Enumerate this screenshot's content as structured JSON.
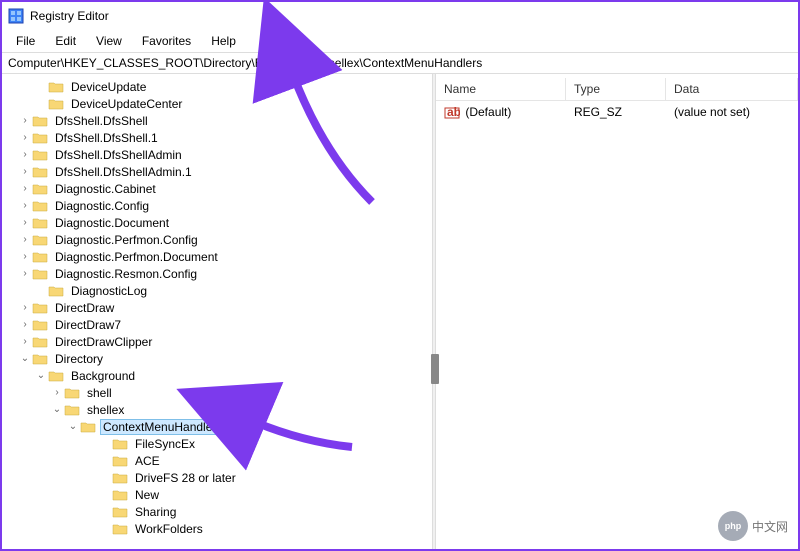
{
  "window": {
    "title": "Registry Editor"
  },
  "menu": {
    "file": "File",
    "edit": "Edit",
    "view": "View",
    "favorites": "Favorites",
    "help": "Help"
  },
  "address": "Computer\\HKEY_CLASSES_ROOT\\Directory\\Background\\shellex\\ContextMenuHandlers",
  "tree": [
    {
      "indent": 2,
      "chev": "none",
      "label": "DeviceUpdate"
    },
    {
      "indent": 2,
      "chev": "none",
      "label": "DeviceUpdateCenter"
    },
    {
      "indent": 1,
      "chev": "closed",
      "label": "DfsShell.DfsShell"
    },
    {
      "indent": 1,
      "chev": "closed",
      "label": "DfsShell.DfsShell.1"
    },
    {
      "indent": 1,
      "chev": "closed",
      "label": "DfsShell.DfsShellAdmin"
    },
    {
      "indent": 1,
      "chev": "closed",
      "label": "DfsShell.DfsShellAdmin.1"
    },
    {
      "indent": 1,
      "chev": "closed",
      "label": "Diagnostic.Cabinet"
    },
    {
      "indent": 1,
      "chev": "closed",
      "label": "Diagnostic.Config"
    },
    {
      "indent": 1,
      "chev": "closed",
      "label": "Diagnostic.Document"
    },
    {
      "indent": 1,
      "chev": "closed",
      "label": "Diagnostic.Perfmon.Config"
    },
    {
      "indent": 1,
      "chev": "closed",
      "label": "Diagnostic.Perfmon.Document"
    },
    {
      "indent": 1,
      "chev": "closed",
      "label": "Diagnostic.Resmon.Config"
    },
    {
      "indent": 2,
      "chev": "none",
      "label": "DiagnosticLog"
    },
    {
      "indent": 1,
      "chev": "closed",
      "label": "DirectDraw"
    },
    {
      "indent": 1,
      "chev": "closed",
      "label": "DirectDraw7"
    },
    {
      "indent": 1,
      "chev": "closed",
      "label": "DirectDrawClipper"
    },
    {
      "indent": 1,
      "chev": "open",
      "label": "Directory"
    },
    {
      "indent": 2,
      "chev": "open",
      "label": "Background"
    },
    {
      "indent": 3,
      "chev": "closed",
      "label": "shell"
    },
    {
      "indent": 3,
      "chev": "open",
      "label": "shellex"
    },
    {
      "indent": 4,
      "chev": "open",
      "label": "ContextMenuHandlers",
      "selected": true
    },
    {
      "indent": 6,
      "chev": "none",
      "label": "FileSyncEx"
    },
    {
      "indent": 6,
      "chev": "none",
      "label": "ACE"
    },
    {
      "indent": 6,
      "chev": "none",
      "label": "DriveFS 28 or later"
    },
    {
      "indent": 6,
      "chev": "none",
      "label": "New"
    },
    {
      "indent": 6,
      "chev": "none",
      "label": "Sharing"
    },
    {
      "indent": 6,
      "chev": "none",
      "label": "WorkFolders"
    }
  ],
  "details": {
    "headers": {
      "name": "Name",
      "type": "Type",
      "data": "Data"
    },
    "rows": [
      {
        "name": "(Default)",
        "type": "REG_SZ",
        "data": "(value not set)"
      }
    ]
  },
  "watermark": {
    "logo": "php",
    "text": "中文网"
  },
  "colors": {
    "folder": "#f8d775",
    "folderStroke": "#c9a93f",
    "arrow": "#7c3aed"
  }
}
